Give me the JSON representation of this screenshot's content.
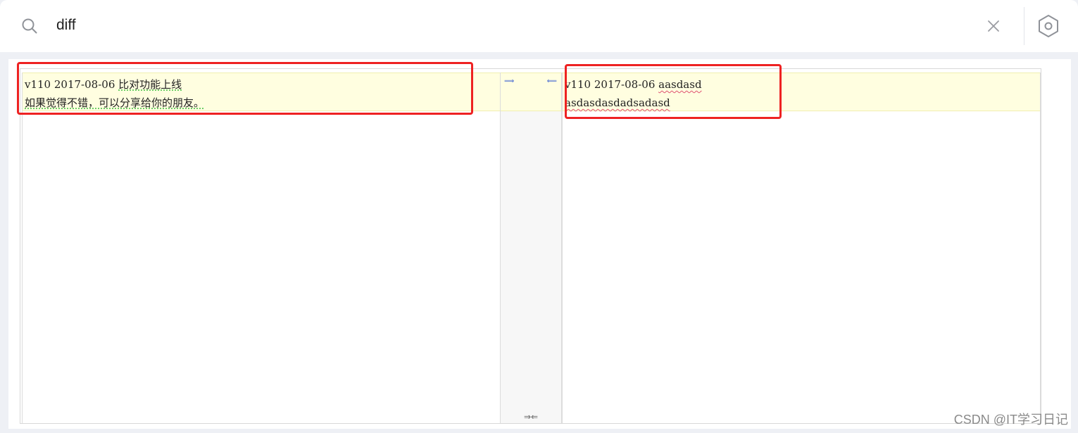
{
  "search": {
    "value": "diff",
    "placeholder": ""
  },
  "icons": {
    "search": "search-icon",
    "clear": "close-icon",
    "plugin": "hexagon-settings-icon",
    "push_right": "arrow-right-icon",
    "push_left": "arrow-left-icon"
  },
  "diff": {
    "left": {
      "line1_prefix": "v110 2017-08-06 ",
      "line1_changed": "比对功能上线",
      "line2": "如果觉得不错，可以分享给你的朋友。"
    },
    "right": {
      "line1_prefix": "v110 2017-08-06 ",
      "line1_changed": "aasdasd",
      "line2": "asdasdasdadsadasd"
    },
    "gap": {
      "push_right": "⟹",
      "push_left": "⟸",
      "footer": "⇒⇐"
    }
  },
  "colors": {
    "changed_background": "#fffee0",
    "annotation_border": "#ee2222",
    "arrow": "#3a5fd0"
  },
  "watermark": "CSDN @IT学习日记"
}
